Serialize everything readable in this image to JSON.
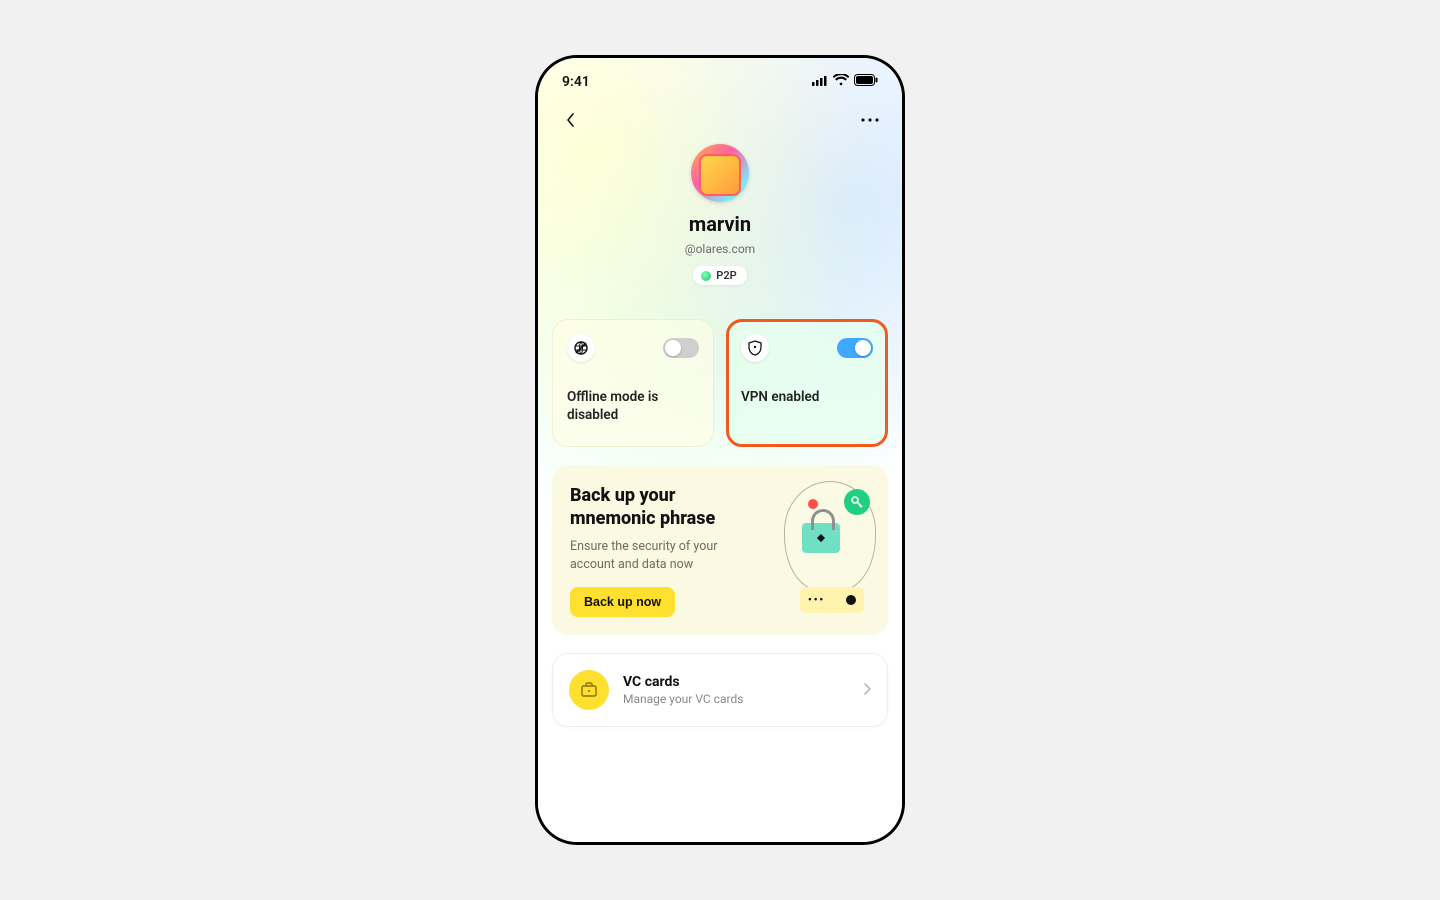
{
  "status": {
    "time": "9:41"
  },
  "profile": {
    "name": "marvin",
    "handle": "@olares.com",
    "badge": "P2P"
  },
  "toggles": {
    "offline": {
      "label": "Offline mode is disabled",
      "enabled": false
    },
    "vpn": {
      "label": "VPN enabled",
      "enabled": true
    }
  },
  "backup": {
    "title": "Back up your mnemonic phrase",
    "subtitle": "Ensure the security of your account and data now",
    "button": "Back up now"
  },
  "vc": {
    "title": "VC cards",
    "subtitle": "Manage your VC cards"
  }
}
